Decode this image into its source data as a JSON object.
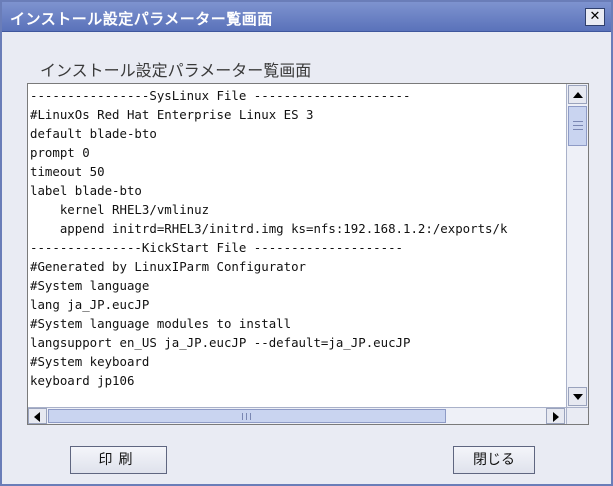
{
  "window": {
    "title": "インストール設定パラメーター覧画面",
    "close_glyph": "✕"
  },
  "subtitle": "インストール設定パラメーター覧画面",
  "content": {
    "lines": [
      "----------------SysLinux File ---------------------",
      "#LinuxOs Red Hat Enterprise Linux ES 3",
      "default blade-bto",
      "prompt 0",
      "timeout 50",
      "label blade-bto",
      "    kernel RHEL3/vmlinuz",
      "    append initrd=RHEL3/initrd.img ks=nfs:192.168.1.2:/exports/k",
      "---------------KickStart File --------------------",
      "#Generated by LinuxIParm Configurator",
      "#System language",
      "lang ja_JP.eucJP",
      "#System language modules to install",
      "langsupport en_US ja_JP.eucJP --default=ja_JP.eucJP",
      "#System keyboard",
      "keyboard jp106"
    ]
  },
  "buttons": {
    "print_label": "印刷",
    "close_label": "閉じる"
  },
  "icons": {
    "scroll_up": "arrow-up-icon",
    "scroll_down": "arrow-down-icon",
    "scroll_left": "arrow-left-icon",
    "scroll_right": "arrow-right-icon",
    "close": "close-icon"
  },
  "colors": {
    "titlebar": "#6a7db8",
    "background": "#e9ebf3",
    "scroll_thumb": "#c9d4f0"
  }
}
